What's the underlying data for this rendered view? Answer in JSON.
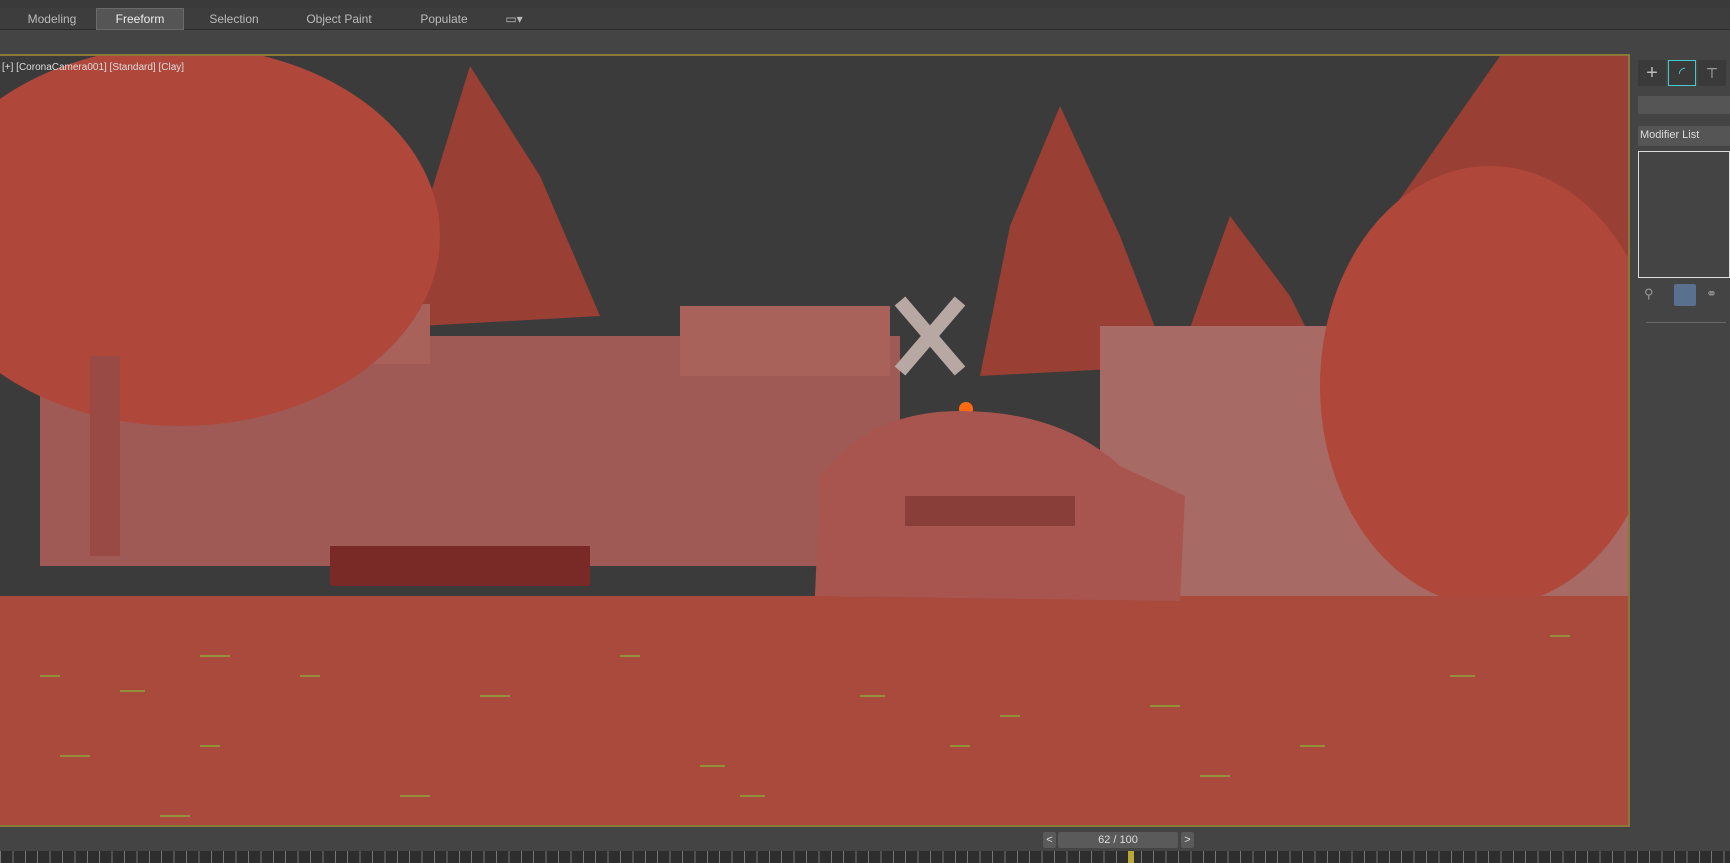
{
  "ribbon": {
    "tabs": [
      {
        "label": "Modeling",
        "active": false
      },
      {
        "label": "Freeform",
        "active": true
      },
      {
        "label": "Selection",
        "active": false
      },
      {
        "label": "Object Paint",
        "active": false
      },
      {
        "label": "Populate",
        "active": false
      }
    ]
  },
  "viewport": {
    "label": "[+] [CoronaCamera001] [Standard] [Clay]"
  },
  "command_panel": {
    "modifier_list": "Modifier List"
  },
  "timeline": {
    "frame": "62 / 100",
    "current": 62,
    "total": 100,
    "prev": "<",
    "next": ">"
  },
  "colors": {
    "clay": "#a94a3c",
    "sky": "#3b3b3b",
    "accent": "#8a7a3a",
    "grass": "#7fd43a"
  }
}
